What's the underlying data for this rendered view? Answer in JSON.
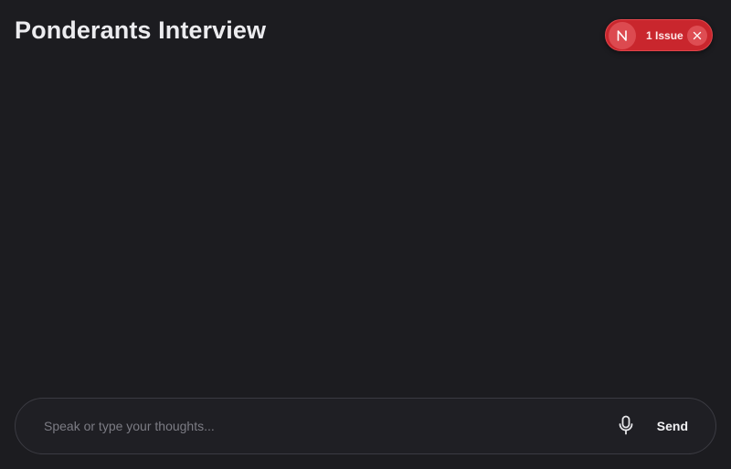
{
  "header": {
    "title": "Ponderants Interview"
  },
  "dev_overlay": {
    "logo_icon": "nextjs-logo-icon",
    "issue_label": "1 Issue",
    "close_icon": "close-icon",
    "accent_color": "#c9262d"
  },
  "composer": {
    "placeholder": "Speak or type your thoughts...",
    "value": "",
    "mic_icon": "microphone-icon",
    "send_label": "Send"
  },
  "colors": {
    "background": "#1c1c20",
    "text": "#ececef",
    "input_border": "#3b3b42"
  }
}
